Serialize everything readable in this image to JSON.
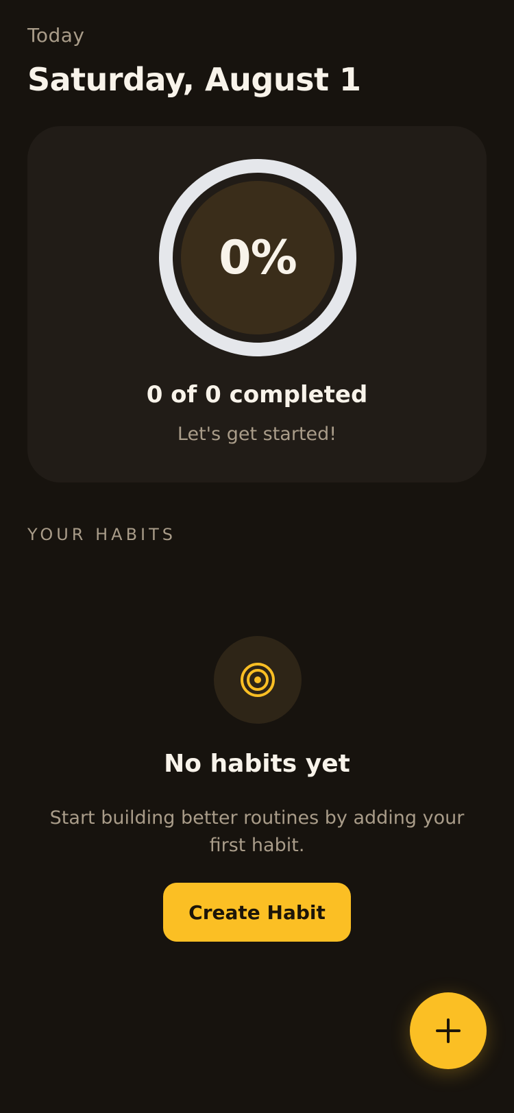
{
  "header": {
    "today_label": "Today",
    "date": "Saturday, August 1"
  },
  "progress": {
    "percent_label": "0%",
    "percent_value": 0,
    "completed_text": "0 of 0 completed",
    "encouragement": "Let's get started!"
  },
  "habits_section": {
    "label": "YOUR HABITS",
    "empty_icon": "target-icon",
    "empty_title": "No habits yet",
    "empty_description": "Start building better routines by adding your first habit.",
    "create_button_label": "Create Habit"
  },
  "fab": {
    "icon": "plus-icon"
  },
  "colors": {
    "background": "#17130e",
    "card": "#211c17",
    "accent": "#fbbf24",
    "ring_track": "#e5e7eb",
    "ring_inner": "#3a2d1a",
    "text_primary": "#f8f3ea",
    "text_secondary": "#a99c89"
  }
}
